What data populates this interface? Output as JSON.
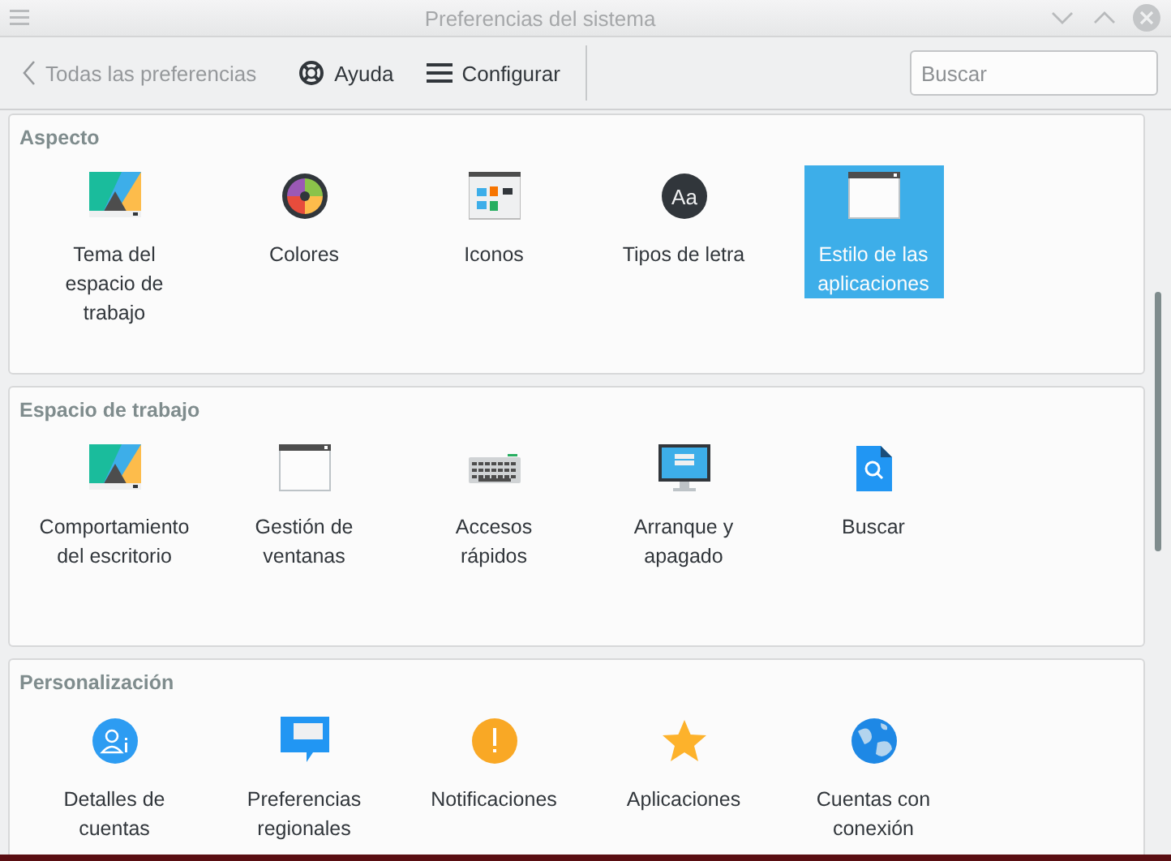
{
  "window": {
    "title": "Preferencias del sistema"
  },
  "toolbar": {
    "back": "Todas las preferencias",
    "back_disabled": true,
    "help": "Ayuda",
    "configure": "Configurar",
    "search": {
      "placeholder": "Buscar"
    }
  },
  "sections": [
    {
      "title": "Aspecto",
      "items": [
        {
          "label": "Tema del espacio de trabajo",
          "selected": false
        },
        {
          "label": "Colores",
          "selected": false
        },
        {
          "label": "Iconos",
          "selected": false
        },
        {
          "label": "Tipos de letra",
          "selected": false,
          "icon_text": "Aa"
        },
        {
          "label": "Estilo de las aplicaciones",
          "selected": true
        }
      ]
    },
    {
      "title": "Espacio de trabajo",
      "items": [
        {
          "label": "Comportamiento del escritorio",
          "selected": false
        },
        {
          "label": "Gestión de ventanas",
          "selected": false
        },
        {
          "label": "Accesos rápidos",
          "selected": false
        },
        {
          "label": "Arranque y apagado",
          "selected": false
        },
        {
          "label": "Buscar",
          "selected": false
        }
      ]
    },
    {
      "title": "Personalización",
      "items": [
        {
          "label": "Detalles de cuentas",
          "selected": false
        },
        {
          "label": "Preferencias regionales",
          "selected": false
        },
        {
          "label": "Notificaciones",
          "selected": false
        },
        {
          "label": "Aplicaciones",
          "selected": false
        },
        {
          "label": "Cuentas con conexión",
          "selected": false
        }
      ]
    }
  ]
}
